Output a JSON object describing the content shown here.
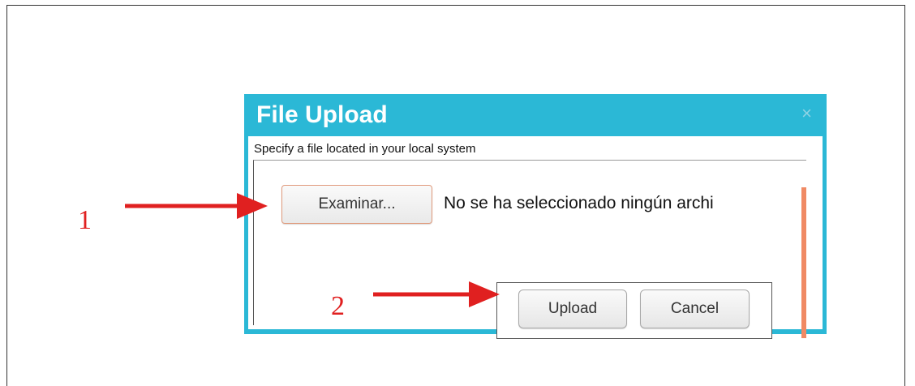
{
  "dialog": {
    "title": "File Upload",
    "close_icon": "×",
    "instructions": "Specify a file located in your local system",
    "browse_button": "Examinar...",
    "no_file_text": "No se ha seleccionado ningún archi",
    "upload_button": "Upload",
    "cancel_button": "Cancel"
  },
  "annotations": {
    "marker_1": "1",
    "marker_2": "2"
  },
  "colors": {
    "title_bar": "#2bb8d6",
    "annotation_red": "#e02020",
    "scrollbar": "#f08a64"
  }
}
